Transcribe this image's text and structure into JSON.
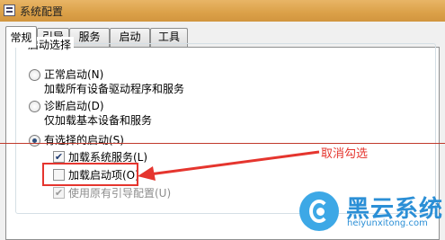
{
  "window": {
    "title": "系统配置"
  },
  "tabs": [
    {
      "label": "常规",
      "active": true
    },
    {
      "label": "引导",
      "active": false
    },
    {
      "label": "服务",
      "active": false
    },
    {
      "label": "启动",
      "active": false
    },
    {
      "label": "工具",
      "active": false
    }
  ],
  "startup_selection": {
    "legend": "启动选择",
    "normal": {
      "label": "正常启动(N)",
      "desc": "加载所有设备驱动程序和服务",
      "selected": false
    },
    "diagnostic": {
      "label": "诊断启动(D)",
      "desc": "仅加载基本设备和服务",
      "selected": false
    },
    "selective": {
      "label": "有选择的启动(S)",
      "selected": true
    },
    "options": [
      {
        "label": "加载系统服务(L)",
        "checked": true,
        "enabled": true
      },
      {
        "label": "加载启动项(O)",
        "checked": false,
        "enabled": true
      },
      {
        "label": "使用原有引导配置(U)",
        "checked": true,
        "enabled": false
      }
    ]
  },
  "annotation": {
    "text": "取消勾选",
    "color": "#e5352e"
  },
  "watermark": {
    "name": "黑云系统",
    "url": "heiyunxitong.com",
    "color": "#2b8fd6"
  },
  "icons": [
    "window-app-icon",
    "radio-button",
    "checkbox-check-icon",
    "red-arrow-icon",
    "heiyun-logo-icon"
  ]
}
